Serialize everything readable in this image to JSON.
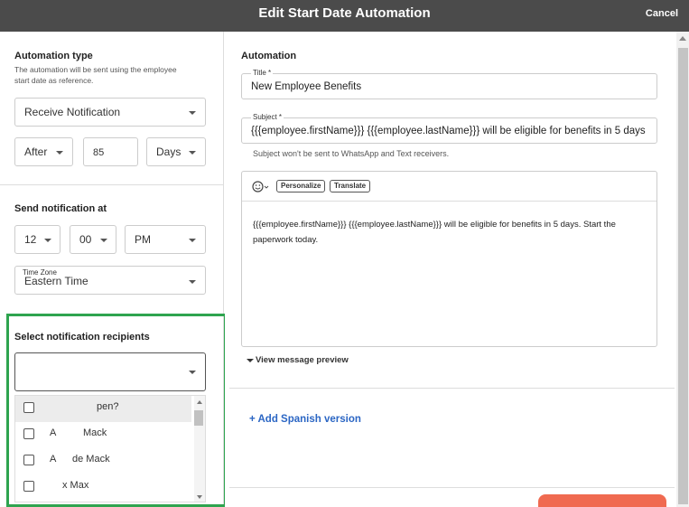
{
  "header": {
    "title": "Edit Start Date Automation",
    "cancel": "Cancel"
  },
  "left": {
    "automation_type": {
      "title": "Automation type",
      "help": "The automation will be sent using the employee start date as reference.",
      "type_value": "Receive Notification",
      "timing": "After",
      "count": "85",
      "unit": "Days"
    },
    "send_at": {
      "title": "Send notification at",
      "hour": "12",
      "minute": "00",
      "ampm": "PM",
      "timezone_label": "Time Zone",
      "timezone": "Eastern Time"
    },
    "recipients": {
      "title": "Select notification recipients",
      "value": "",
      "options": [
        "pen?",
        "Mack",
        "de Mack",
        "x Max"
      ]
    }
  },
  "right": {
    "section_title": "Automation",
    "title_label": "Title *",
    "title_value": "New Employee Benefits",
    "subject_label": "Subject *",
    "subject_value": "{{{employee.firstName}}} {{{employee.lastName}}} will be eligible for benefits in 5 days",
    "subject_note": "Subject won't be sent to WhatsApp and Text receivers.",
    "toolbar": {
      "personalize": "Personalize",
      "translate": "Translate"
    },
    "body_text": "{{{employee.firstName}}} {{{employee.lastName}}} will be eligible for benefits in 5 days. Start the paperwork today.",
    "preview_link": "View message preview",
    "add_language": "+ Add Spanish version"
  },
  "colors": {
    "header_bg": "#4b4b4b",
    "highlight": "#2ea44f",
    "link": "#2b66c4",
    "primary_button": "#f06a50"
  },
  "icons": {
    "emoji": "smiley-icon"
  }
}
